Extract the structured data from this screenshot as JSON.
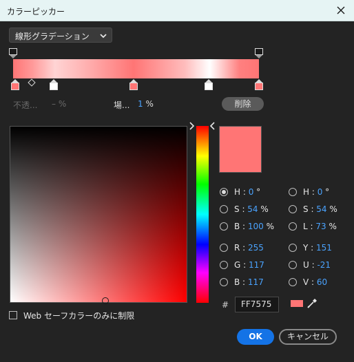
{
  "window": {
    "title": "カラーピッカー"
  },
  "gradient_type": {
    "selected": "線形グラデーション"
  },
  "stop_row": {
    "opacity_label": "不透...",
    "opacity_value": "–",
    "opacity_unit": "%",
    "location_label": "場...",
    "location_value": "1",
    "location_unit": "%",
    "delete_label": "削除"
  },
  "color_fields": [
    {
      "letter": "H",
      "value": "0",
      "unit": "°",
      "selected": true
    },
    {
      "letter": "S",
      "value": "54",
      "unit": "%",
      "selected": false
    },
    {
      "letter": "B",
      "value": "100",
      "unit": "%",
      "selected": false
    },
    {
      "letter": "R",
      "value": "255",
      "unit": "",
      "selected": false
    },
    {
      "letter": "G",
      "value": "117",
      "unit": "",
      "selected": false
    },
    {
      "letter": "B",
      "value": "117",
      "unit": "",
      "selected": false
    },
    {
      "letter": "H",
      "value": "0",
      "unit": "°",
      "selected": false
    },
    {
      "letter": "S",
      "value": "54",
      "unit": "%",
      "selected": false
    },
    {
      "letter": "L",
      "value": "73",
      "unit": "%",
      "selected": false
    },
    {
      "letter": "Y",
      "value": "151",
      "unit": "",
      "selected": false
    },
    {
      "letter": "U",
      "value": "-21",
      "unit": "",
      "selected": false
    },
    {
      "letter": "V",
      "value": "60",
      "unit": "",
      "selected": false
    }
  ],
  "hex": {
    "hash": "#",
    "value": "FF7575"
  },
  "web_safe": {
    "label": "Web セーフカラーのみに制限",
    "checked": false
  },
  "buttons": {
    "ok": "OK",
    "cancel": "キャンセル"
  },
  "colors": {
    "current": "#ff7575",
    "accent": "#1473e6",
    "value_text": "#4aa3ff"
  },
  "icons": {
    "close": "close-icon",
    "chevron": "chevron-down-icon",
    "eyedropper": "eyedropper-icon"
  }
}
